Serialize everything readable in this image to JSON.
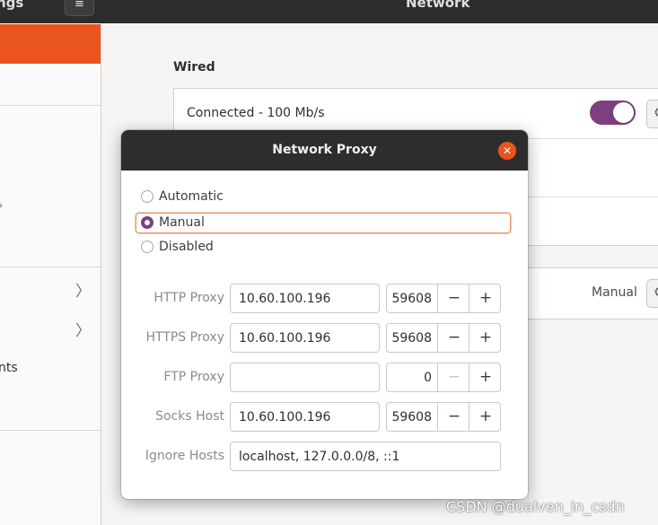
{
  "header": {
    "app_title": "ngs",
    "menu_icon": "hamburger-icon",
    "menu_glyph": "≡",
    "window_title": "Network"
  },
  "sidebar": {
    "active_color": "#e95420",
    "visible_text": "nts",
    "chevron_glyph": "〉",
    "marker_glyph": "›"
  },
  "main": {
    "wired": {
      "heading": "Wired",
      "connection_status": "Connected - 100 Mb/s",
      "toggle_on": true,
      "toggle_color": "#7d3f80"
    },
    "proxy_mode": "Manual",
    "gear_glyph": "⚙"
  },
  "dialog": {
    "title": "Network Proxy",
    "close_glyph": "✕",
    "methods": [
      {
        "label": "Automatic",
        "selected": false
      },
      {
        "label": "Manual",
        "selected": true
      },
      {
        "label": "Disabled",
        "selected": false
      }
    ],
    "proxies": [
      {
        "label": "HTTP Proxy",
        "host": "10.60.100.196",
        "port": "59608",
        "minus_enabled": true
      },
      {
        "label": "HTTPS Proxy",
        "host": "10.60.100.196",
        "port": "59608",
        "minus_enabled": true
      },
      {
        "label": "FTP Proxy",
        "host": "",
        "port": "0",
        "minus_enabled": false
      },
      {
        "label": "Socks Host",
        "host": "10.60.100.196",
        "port": "59608",
        "minus_enabled": true
      }
    ],
    "ignore_hosts": {
      "label": "Ignore Hosts",
      "value": "localhost, 127.0.0.0/8, ::1"
    },
    "minus_glyph": "−",
    "plus_glyph": "+"
  },
  "watermark": "CSDN @dualven_in_csdn"
}
